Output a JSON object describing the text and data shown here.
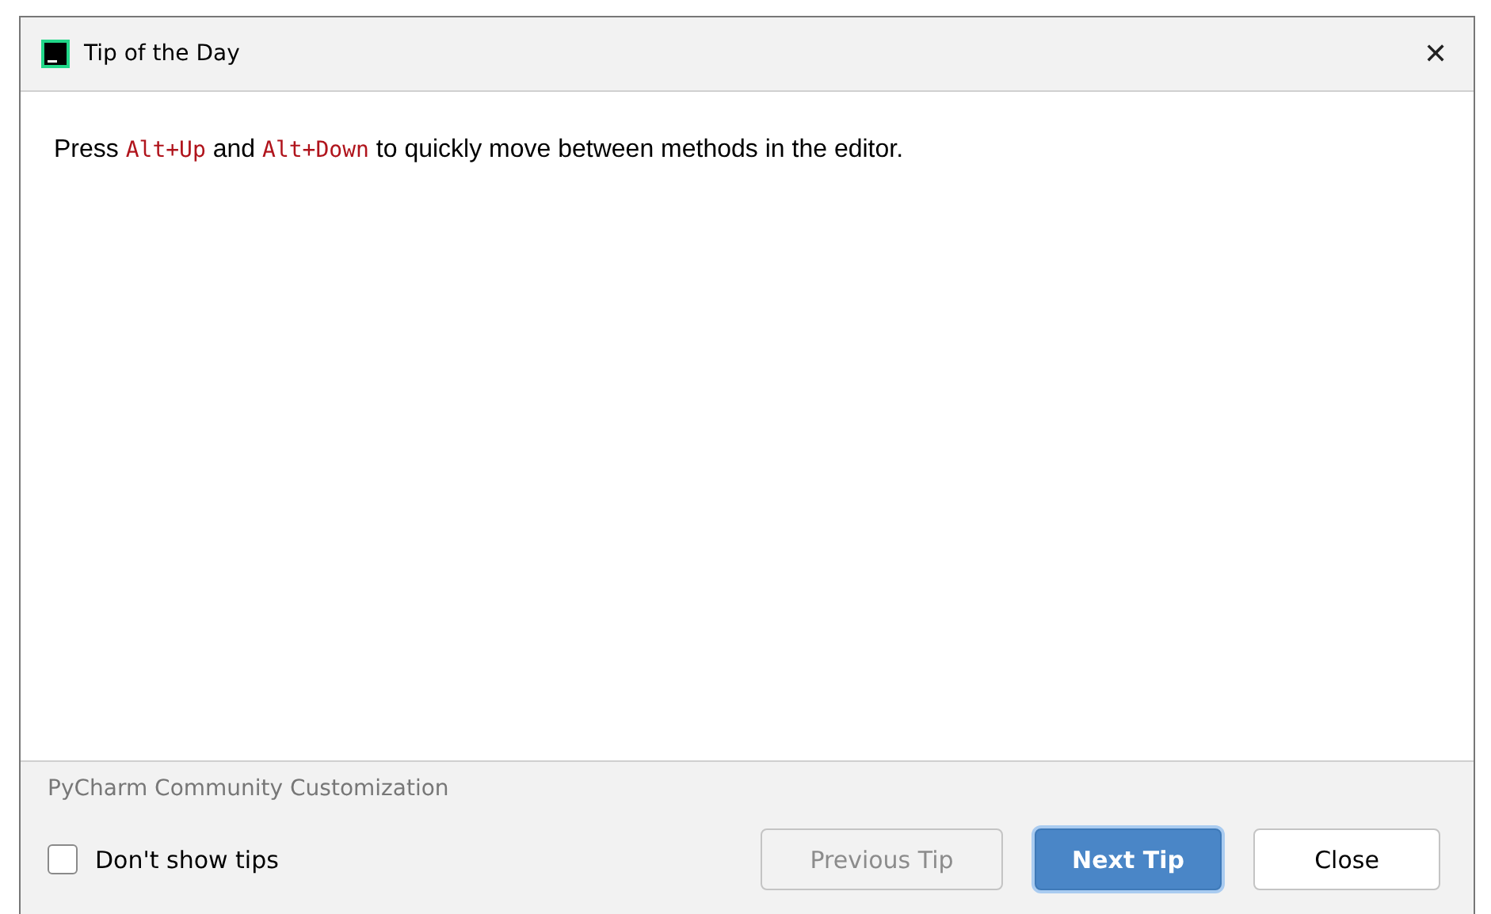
{
  "window": {
    "title": "Tip of the Day",
    "close": "✕"
  },
  "tip": [
    {
      "kind": "plain",
      "text": "Press "
    },
    {
      "kind": "shortcut",
      "text": "Alt+Up"
    },
    {
      "kind": "plain",
      "text": " and "
    },
    {
      "kind": "shortcut",
      "text": "Alt+Down"
    },
    {
      "kind": "plain",
      "text": " to quickly move between methods in the editor."
    }
  ],
  "source": "PyCharm Community Customization",
  "dont_show": {
    "label": "Don't show tips",
    "checked": false
  },
  "buttons": [
    {
      "label": "Previous Tip",
      "disabled": true,
      "default": false
    },
    {
      "label": "Next Tip",
      "disabled": false,
      "default": true
    },
    {
      "label": "Close",
      "disabled": false,
      "default": false
    }
  ]
}
